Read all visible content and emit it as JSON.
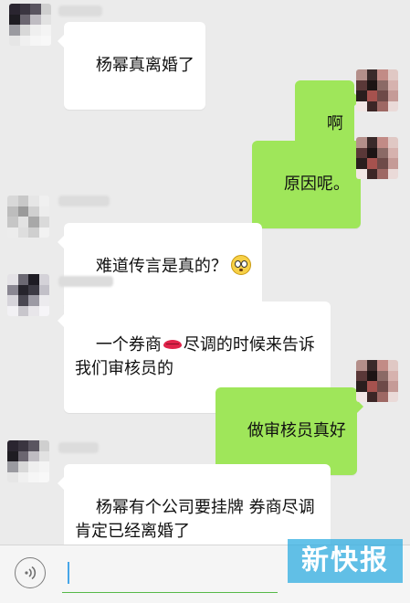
{
  "colors": {
    "chat_background": "#ebebeb",
    "incoming_bubble": "#ffffff",
    "outgoing_bubble": "#9fe65a",
    "input_underline": "#56b948",
    "cursor": "#46a6e8",
    "watermark": "#28aae1"
  },
  "messages": [
    {
      "side": "incoming",
      "text": "杨幂真离婚了"
    },
    {
      "side": "outgoing",
      "text": "啊"
    },
    {
      "side": "outgoing",
      "text": "原因呢。"
    },
    {
      "side": "incoming",
      "text": "难道传言是真的？",
      "emoji": "flushed-face-emoji"
    },
    {
      "side": "incoming",
      "text_before": "一个券商",
      "emoji": "lips-emoji",
      "text_after": "尽调的时候来告诉\n我们审核员的"
    },
    {
      "side": "outgoing",
      "text": "做审核员真好"
    },
    {
      "side": "incoming",
      "text": "杨幂有个公司要挂牌 券商尽调\n肯定已经离婚了"
    }
  ],
  "input_bar": {
    "voice_icon": "voice-input-icon",
    "text_value": ""
  },
  "watermark": {
    "text": "新快报"
  }
}
